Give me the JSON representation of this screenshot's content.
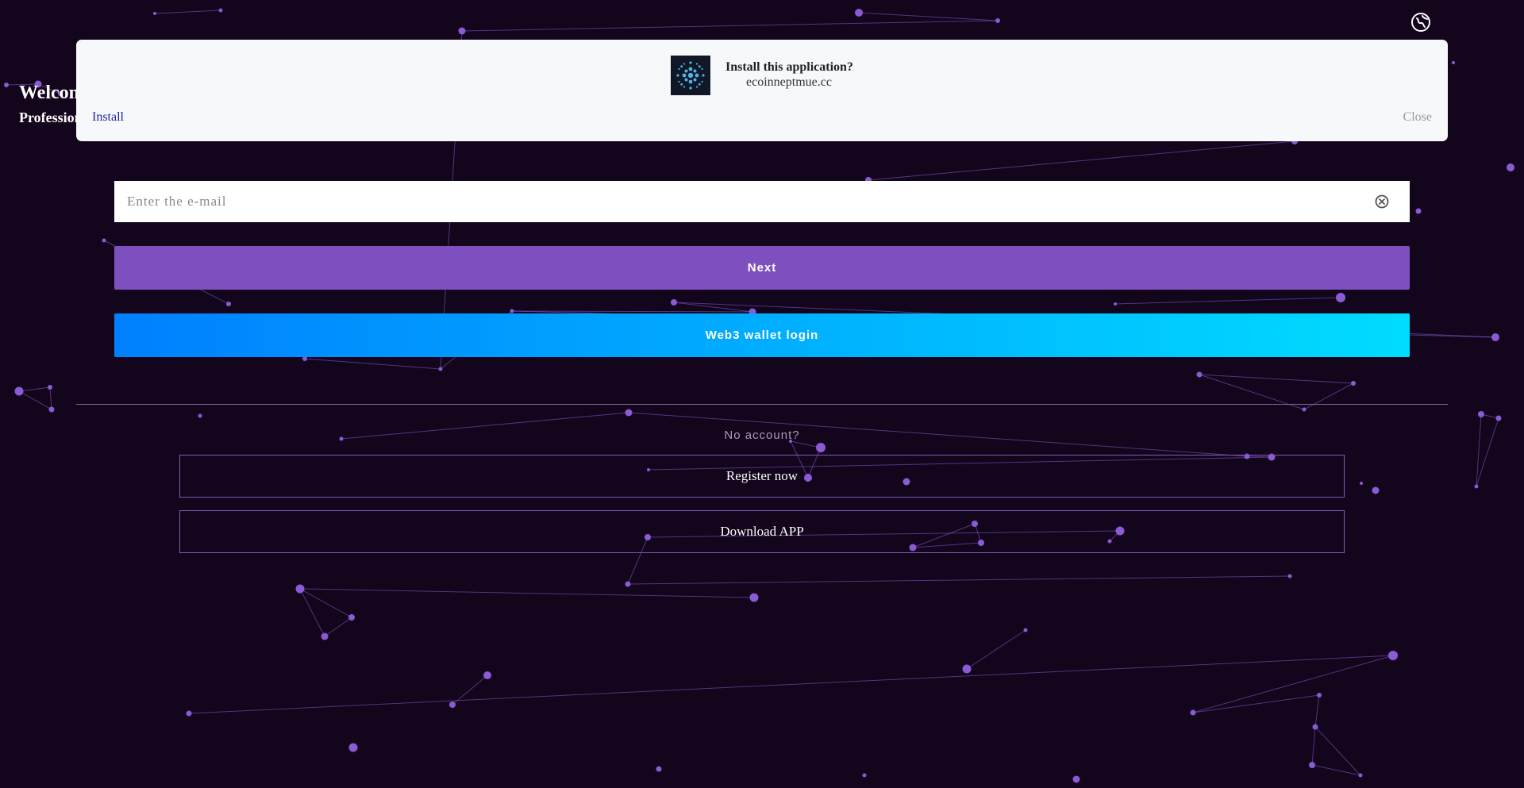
{
  "header": {
    "welcome": "Welcom",
    "subtitle": "Profession"
  },
  "language_icon": "globe-language-icon",
  "install_banner": {
    "question": "Install this application?",
    "domain": "ecoinneptmue.cc",
    "install_label": "Install",
    "close_label": "Close",
    "icon": "app-logo-icon"
  },
  "login": {
    "email_placeholder": "Enter the e-mail",
    "email_value": "",
    "clear_icon": "clear-circle-icon",
    "next_label": "Next",
    "web3_label": "Web3 wallet login"
  },
  "footer": {
    "no_account": "No account?",
    "register_label": "Register now",
    "download_label": "Download APP"
  },
  "colors": {
    "background": "#12051c",
    "particle": "#8a5bd4",
    "primary": "#7e50bf",
    "web3_start": "#0080ff",
    "web3_end": "#00dcff",
    "banner_bg": "#f7f8fa",
    "install_link": "#2323a6"
  }
}
